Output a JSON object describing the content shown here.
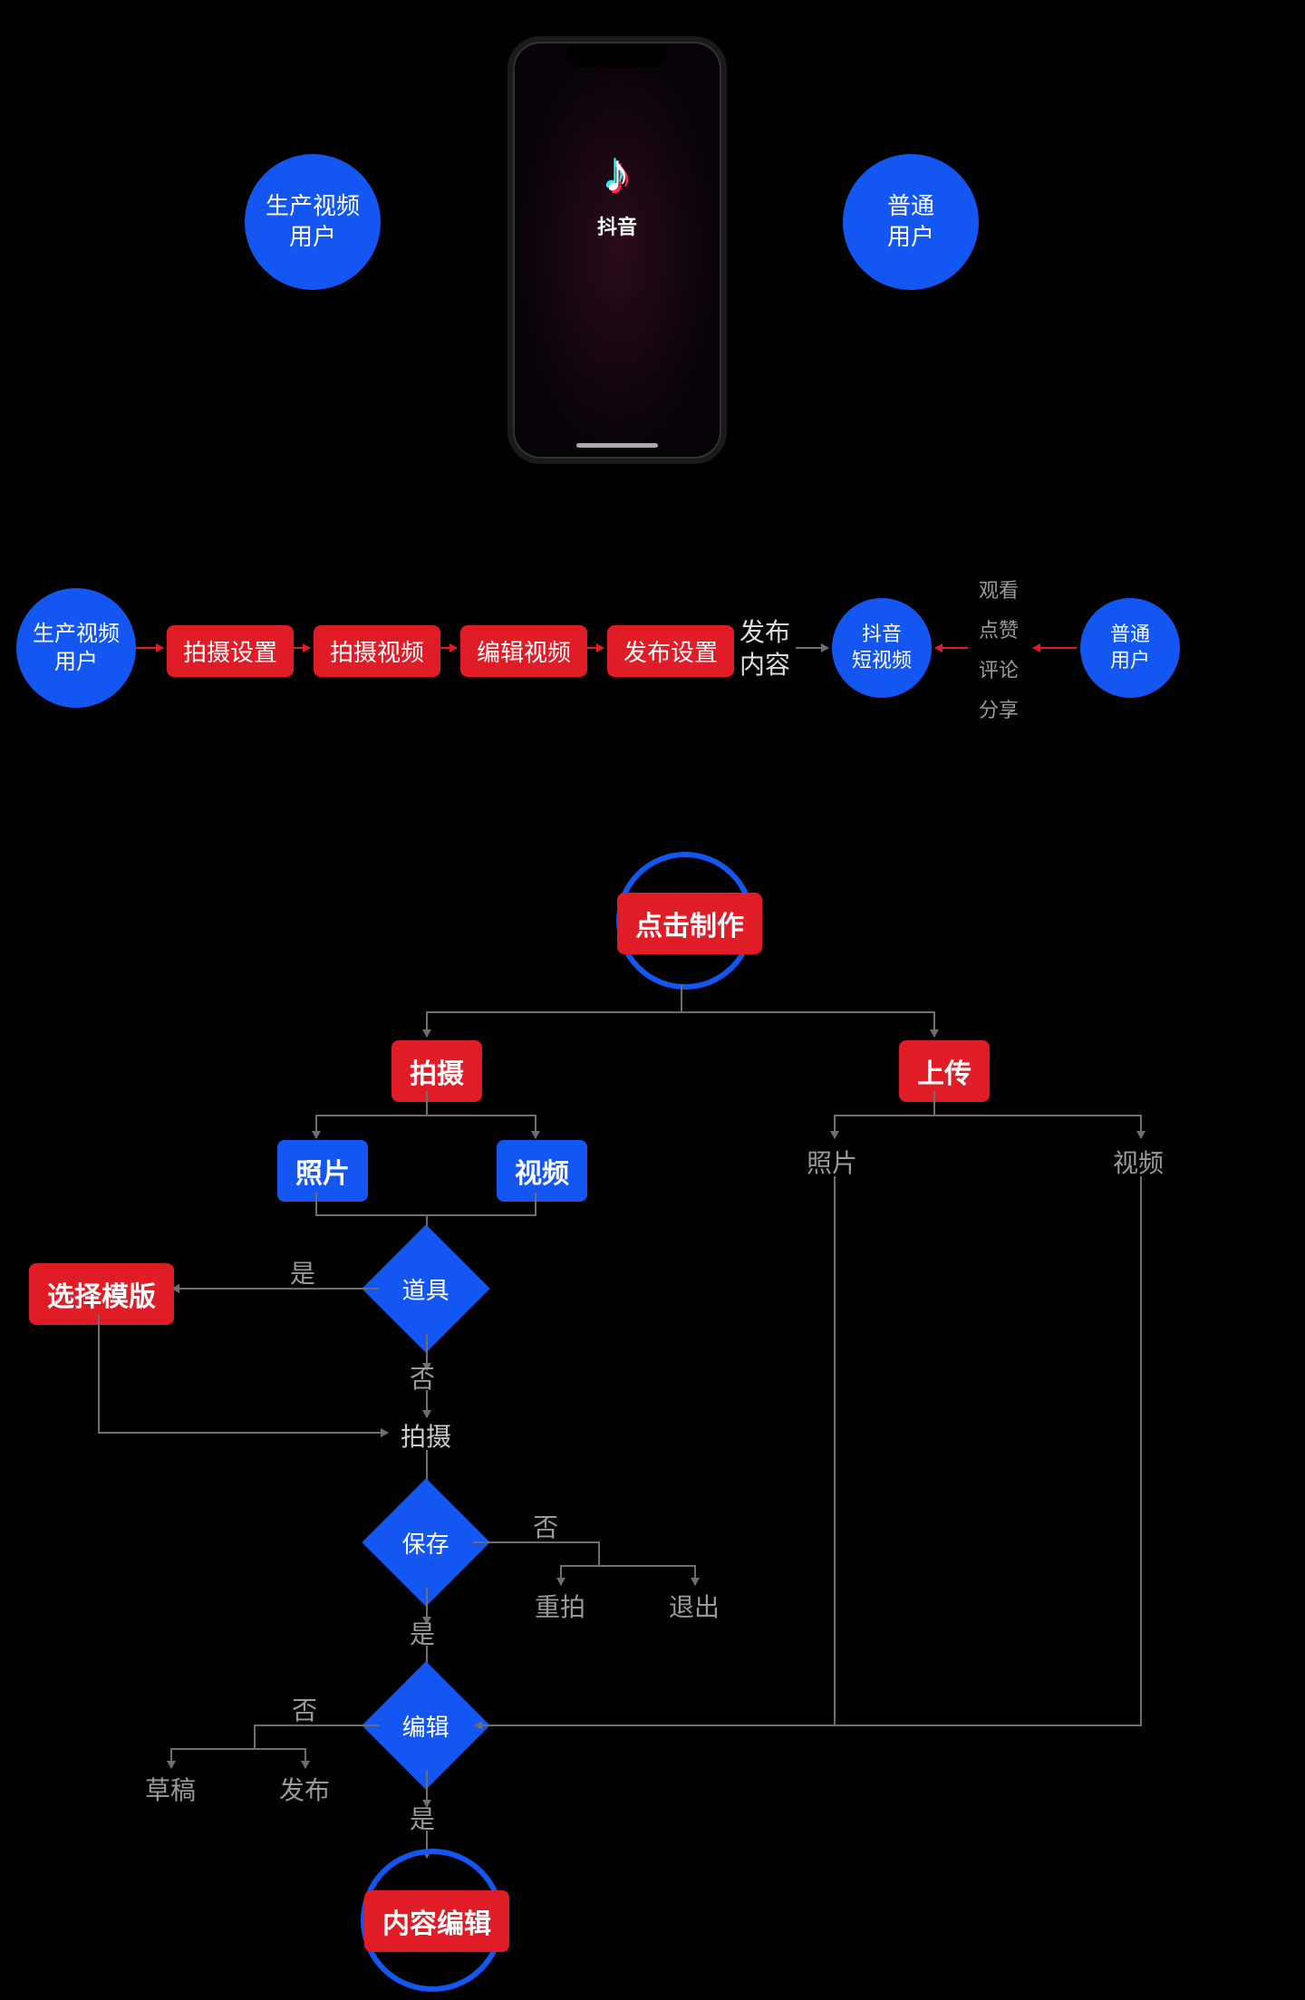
{
  "top": {
    "creator_user": "生产视频\n用户",
    "normal_user": "普通\n用户",
    "app_name": "抖音"
  },
  "pipeline": {
    "creator_user": "生产视频\n用户",
    "steps": [
      "拍摄设置",
      "拍摄视频",
      "编辑视频",
      "发布设置"
    ],
    "publish": "发布\n内容",
    "short_video": "抖音\n短视频",
    "actions": [
      "观看",
      "点赞",
      "评论",
      "分享"
    ],
    "normal_user": "普通\n用户"
  },
  "flow": {
    "start": "点击制作",
    "shoot": "拍摄",
    "upload": "上传",
    "photo": "照片",
    "video": "视频",
    "upload_photo": "照片",
    "upload_video": "视频",
    "props": "道具",
    "yes": "是",
    "no": "否",
    "select_template": "选择模版",
    "shoot_action": "拍摄",
    "save": "保存",
    "retake": "重拍",
    "exit": "退出",
    "edit": "编辑",
    "draft": "草稿",
    "publish": "发布",
    "content_edit": "内容编辑"
  }
}
